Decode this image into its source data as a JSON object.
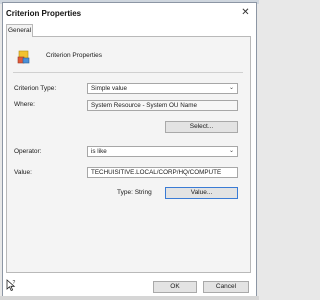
{
  "window": {
    "title": "Criterion Properties",
    "close_glyph": "✕"
  },
  "tabs": [
    {
      "label": "General"
    }
  ],
  "header": {
    "heading": "Criterion Properties",
    "icon": "criterion-properties-icon"
  },
  "form": {
    "criterion_type": {
      "label": "Criterion Type:",
      "value": "Simple value"
    },
    "where": {
      "label": "Where:",
      "value": "System Resource - System OU Name"
    },
    "select_button": "Select...",
    "operator": {
      "label": "Operator:",
      "value": "is like"
    },
    "value": {
      "label": "Value:",
      "value": "TECHUISITIVE.LOCAL/CORP/HQ/COMPUTE"
    },
    "type_text": "Type: String",
    "value_button": "Value..."
  },
  "footer": {
    "ok_label": "OK",
    "cancel_label": "Cancel",
    "icon": "help-cursor-icon"
  },
  "dropdown_glyph": "⌄",
  "colors": {
    "focus_border": "#3a7bd5",
    "icon_yellow": "#f2c230",
    "icon_red": "#e05a3c"
  }
}
